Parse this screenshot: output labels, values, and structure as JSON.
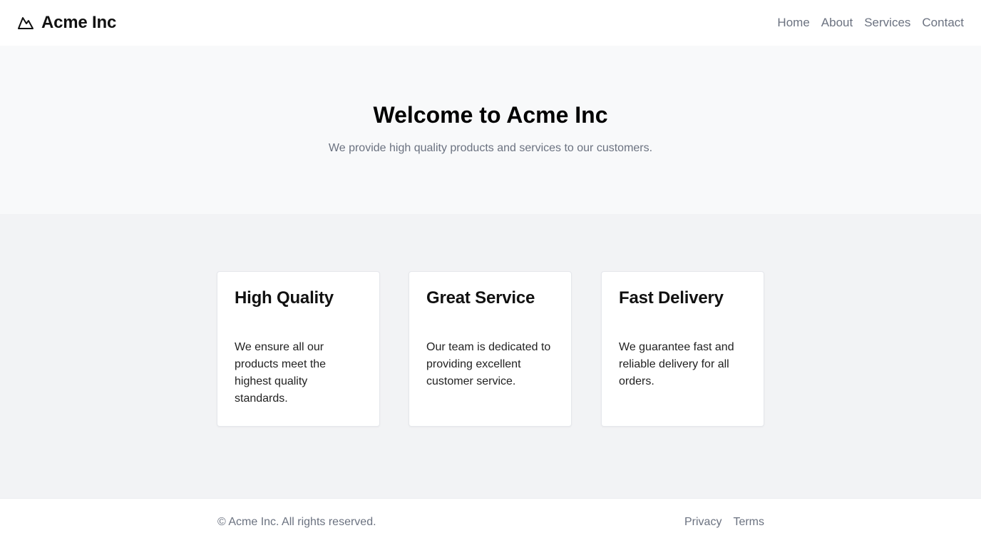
{
  "header": {
    "brand": "Acme Inc",
    "logo_icon": "mountain-icon",
    "nav": [
      "Home",
      "About",
      "Services",
      "Contact"
    ]
  },
  "hero": {
    "title": "Welcome to Acme Inc",
    "subtitle": "We provide high quality products and services to our customers."
  },
  "features": [
    {
      "title": "High Quality",
      "text": "We ensure all our products meet the highest quality standards."
    },
    {
      "title": "Great Service",
      "text": "Our team is dedicated to providing excellent customer service."
    },
    {
      "title": "Fast Delivery",
      "text": "We guarantee fast and reliable delivery for all orders."
    }
  ],
  "footer": {
    "copyright": "© Acme Inc. All rights reserved.",
    "links": [
      "Privacy",
      "Terms"
    ]
  },
  "colors": {
    "hero_bg": "#f8f9fa",
    "features_bg": "#f2f3f5",
    "muted_text": "#6b7280"
  }
}
